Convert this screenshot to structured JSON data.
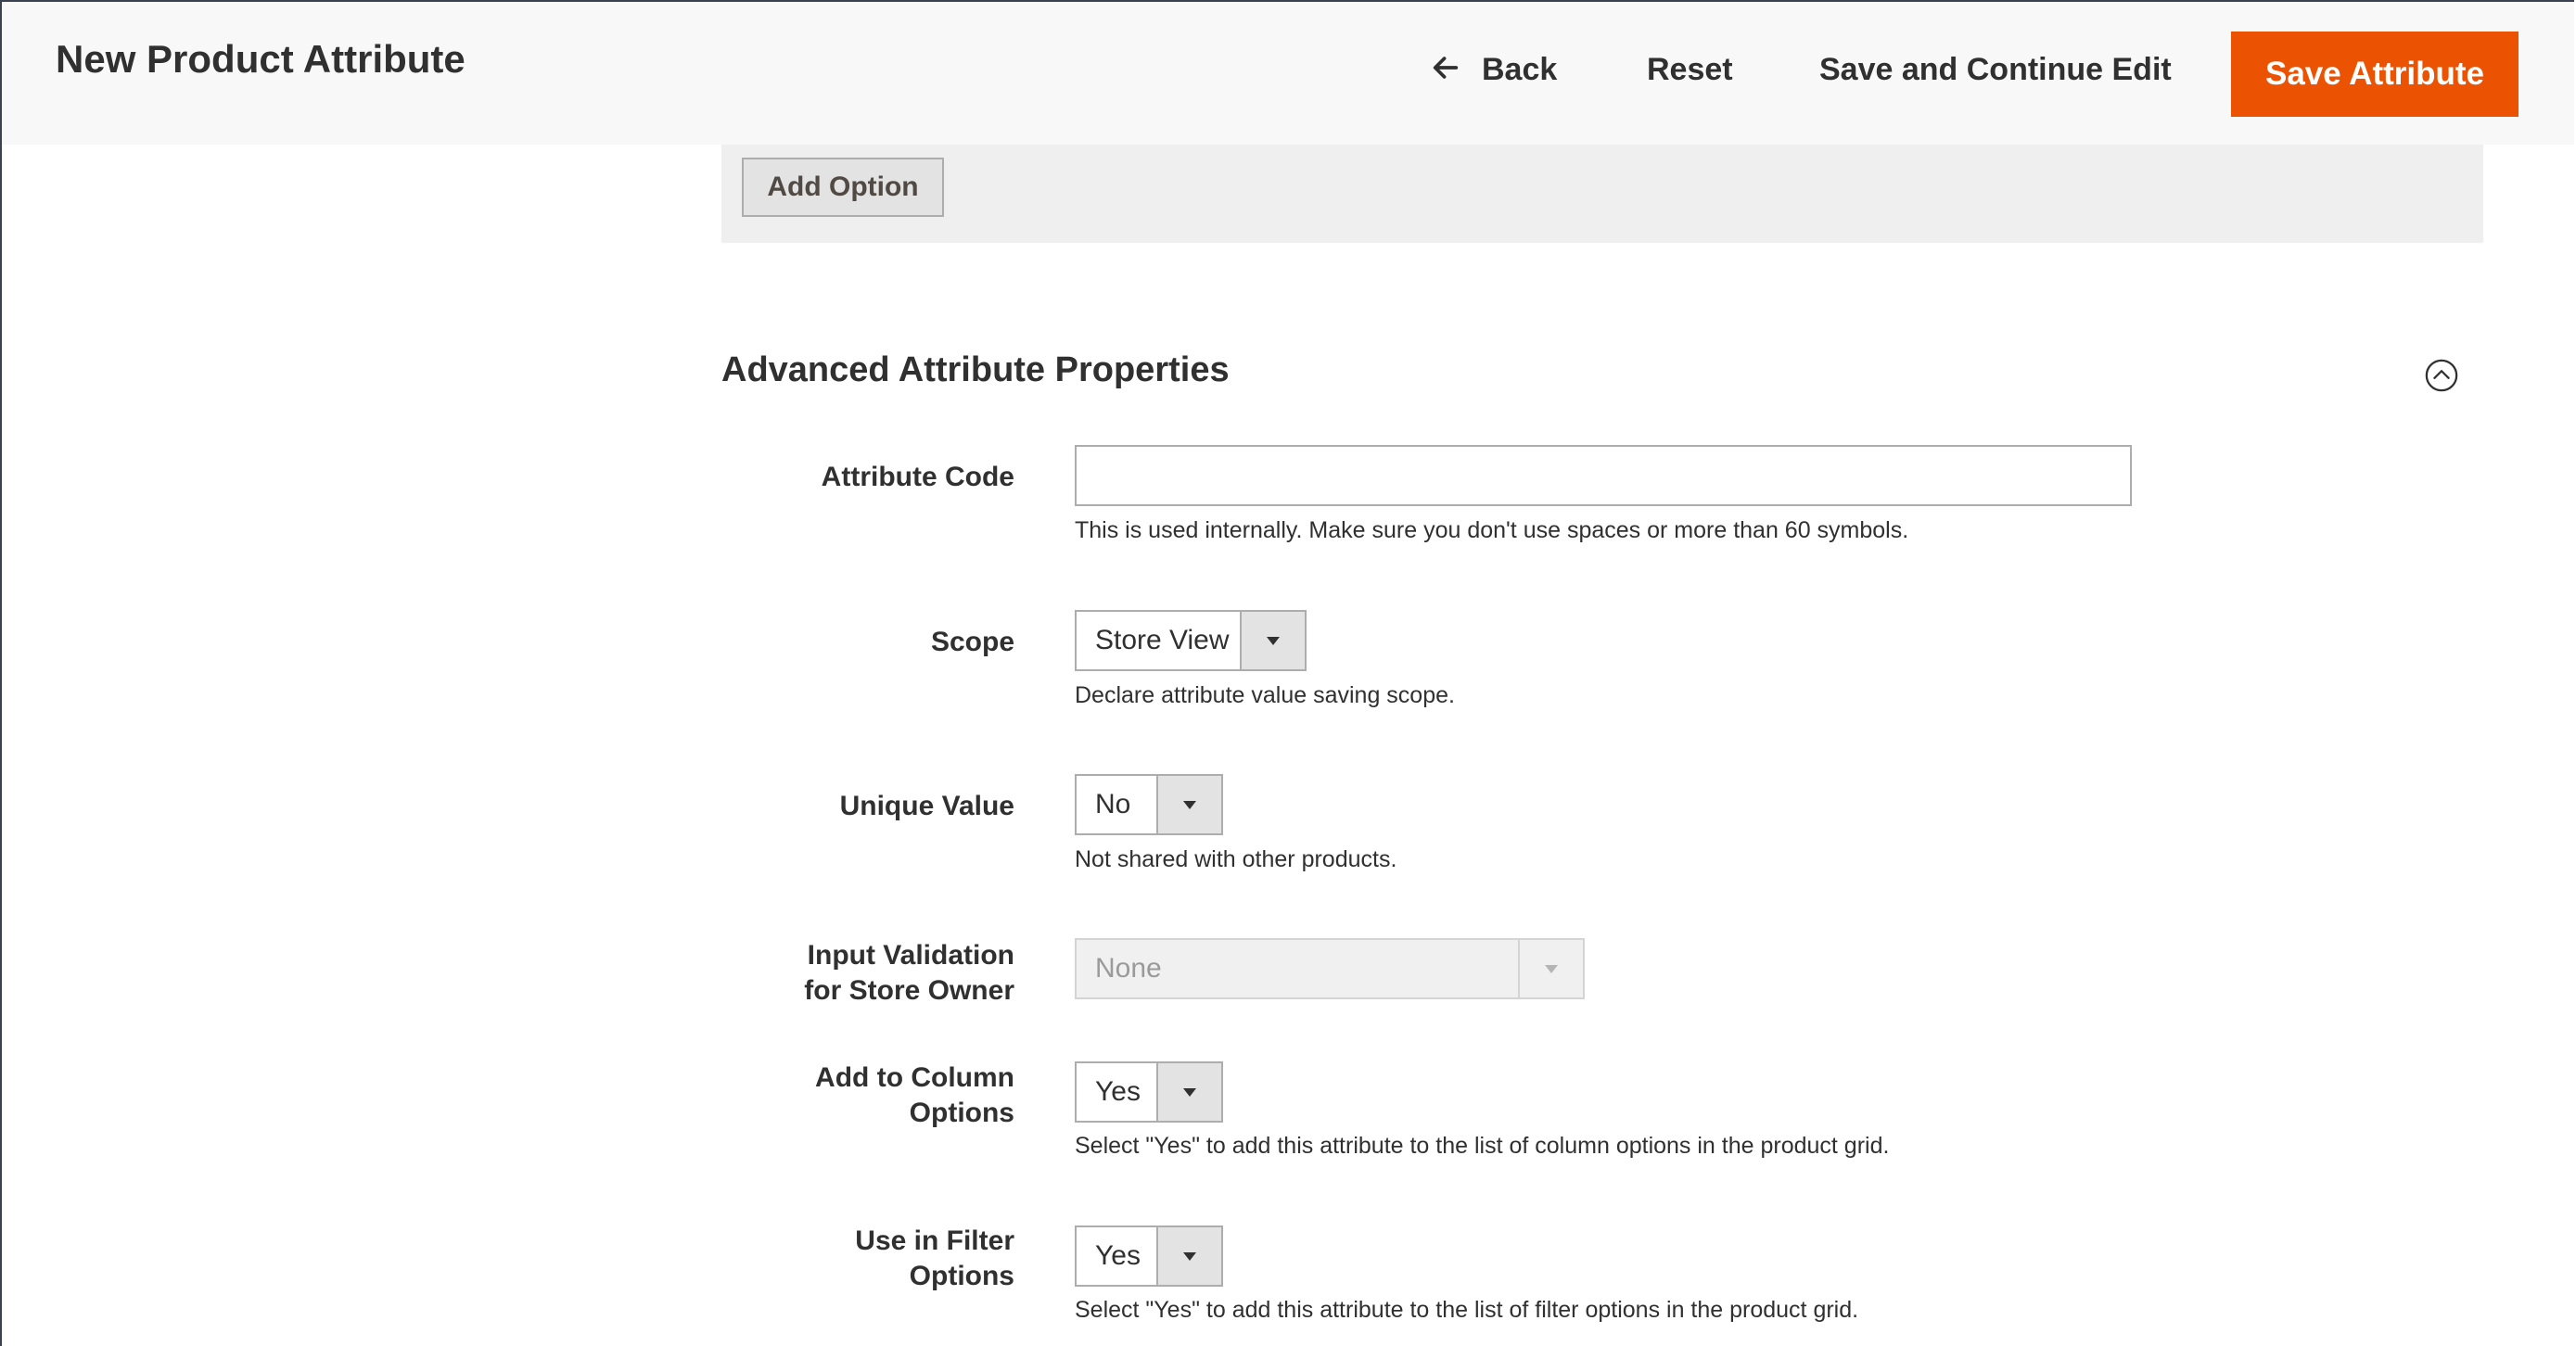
{
  "header": {
    "title": "New Product Attribute",
    "back_label": "Back",
    "reset_label": "Reset",
    "save_continue_label": "Save and Continue Edit",
    "save_label": "Save Attribute"
  },
  "options_panel": {
    "add_option_label": "Add Option"
  },
  "section": {
    "title": "Advanced Attribute Properties"
  },
  "fields": {
    "attribute_code": {
      "label": "Attribute Code",
      "value": "",
      "note": "This is used internally. Make sure you don't use spaces or more than 60 symbols."
    },
    "scope": {
      "label": "Scope",
      "value": "Store View",
      "note": "Declare attribute value saving scope."
    },
    "unique_value": {
      "label": "Unique Value",
      "value": "No",
      "note": "Not shared with other products."
    },
    "input_validation": {
      "label_line1": "Input Validation",
      "label_line2": "for Store Owner",
      "value": "None"
    },
    "add_to_column": {
      "label_line1": "Add to Column",
      "label_line2": "Options",
      "value": "Yes",
      "note": "Select \"Yes\" to add this attribute to the list of column options in the product grid."
    },
    "use_in_filter": {
      "label_line1": "Use in Filter",
      "label_line2": "Options",
      "value": "Yes",
      "note": "Select \"Yes\" to add this attribute to the list of filter options in the product grid."
    }
  },
  "colors": {
    "primary_button": "#eb5202",
    "header_bg": "#f8f8f8",
    "text": "#303030"
  },
  "icons": {
    "back": "arrow-left-icon",
    "collapse": "chevron-up-circle-icon",
    "select_arrow": "caret-down-icon"
  }
}
